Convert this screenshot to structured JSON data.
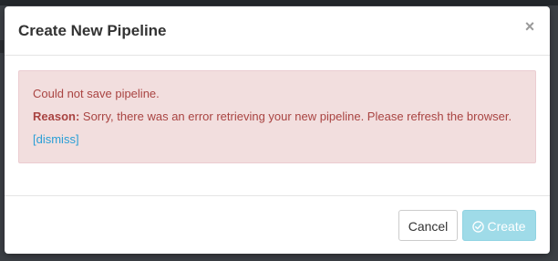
{
  "modal": {
    "title": "Create New Pipeline",
    "close_glyph": "×"
  },
  "alert": {
    "message": "Could not save pipeline.",
    "reason_label": "Reason:",
    "reason_text": " Sorry, there was an error retrieving your new pipeline. Please refresh the browser.",
    "dismiss_label": "[dismiss]",
    "colors": {
      "background": "#f2dede",
      "text": "#a94442",
      "link": "#2a9fd6"
    }
  },
  "footer": {
    "cancel_label": "Cancel",
    "create_label": "Create",
    "create_icon": "check-circle-icon",
    "create_disabled": true
  }
}
